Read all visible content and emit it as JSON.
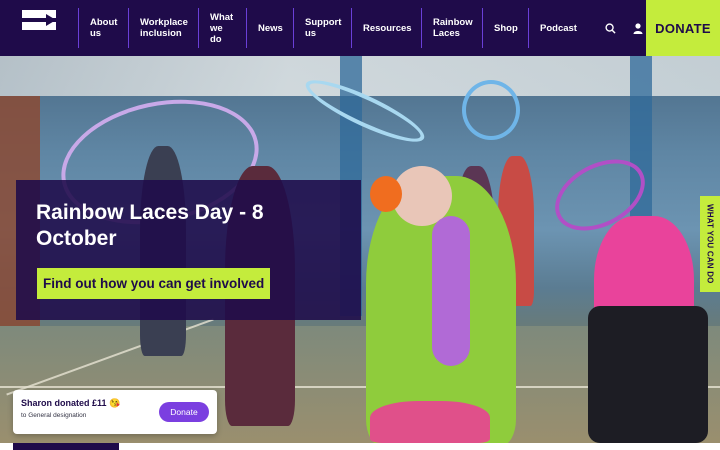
{
  "header": {
    "logo_icon": "brand-logo-icon",
    "nav_items": [
      {
        "label": "About us"
      },
      {
        "label": "Workplace inclusion"
      },
      {
        "label": "What we do"
      },
      {
        "label": "News"
      },
      {
        "label": "Support us"
      },
      {
        "label": "Resources"
      },
      {
        "label": "Rainbow Laces"
      },
      {
        "label": "Shop"
      },
      {
        "label": "Podcast"
      }
    ],
    "search_icon": "search-icon",
    "account_icon": "user-icon",
    "donate_label": "DONATE"
  },
  "hero": {
    "title": "Rainbow Laces Day - 8 October",
    "cta_label": "Find out how you can get involved",
    "side_tab_label": "WHAT YOU CAN DO"
  },
  "toast": {
    "title": "Sharon donated £11 😘",
    "subtitle": "to General designation",
    "button_label": "Donate"
  },
  "colors": {
    "brand_dark": "#1f0b4a",
    "accent_lime": "#c4ec3c",
    "button_purple": "#7b3fe0",
    "divider_purple": "#6a3fd8"
  }
}
